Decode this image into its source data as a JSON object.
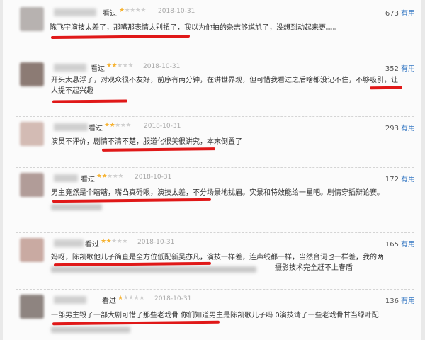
{
  "reviews": [
    {
      "status": "看过",
      "rating": 1,
      "date": "2018-10-31",
      "votes": "673",
      "useful_label": "有用",
      "comment": "陈飞宇演技太差了，那嘴那表情太别扭了，我以为他拍的杂志够尴尬了，没想到动起来更。。。"
    },
    {
      "status": "看过",
      "rating": 2,
      "date": "2018-10-31",
      "votes": "352",
      "useful_label": "有用",
      "comment": "开头太悬浮了，对观众很不友好，前序有两分钟，在讲世界观，但可惜我看过之后啥都没记不住，不够吸引，让人提不起兴趣"
    },
    {
      "status": "看过",
      "rating": 2,
      "date": "2018-10-31",
      "votes": "293",
      "useful_label": "有用",
      "comment": "演员不评价，剧情不清不楚，服道化很美很讲究，本末倒置了"
    },
    {
      "status": "看过",
      "rating": 2,
      "date": "2018-10-31",
      "votes": "172",
      "useful_label": "有用",
      "comment": "男主竟然是个瞎瞎，嘴凸真碍眼，演技太差，不分场景地扰眉。实景和特效能给一星吧。剧情穿插辩论赛。"
    },
    {
      "status": "看过",
      "rating": 2,
      "date": "2018-10-31",
      "votes": "165",
      "useful_label": "有用",
      "comment": "妈呀，陈凯歌他儿子简直是全方位低配新吴亦凡，演技一样差，连声线都一样，当然台词也一样差，我的两",
      "comment_tail": "摄影技术完全赶不上春盾"
    },
    {
      "status": "看过",
      "rating": 1,
      "date": "2018-10-31",
      "votes": "136",
      "useful_label": "有用",
      "comment": "一部男主毁了一部大剧可惜了那些老戏骨 你们知道男主是陈凯歌儿子吗 0演技请了一些老戏骨甘当绿叶配"
    }
  ],
  "colors": {
    "highlight": "#e01818",
    "star_on": "#f6b332",
    "useful_link": "#3779c4"
  }
}
